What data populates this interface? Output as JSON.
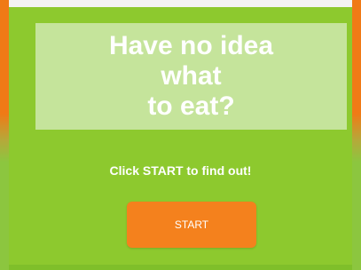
{
  "headline": {
    "line1": "Have no idea",
    "line2": "what",
    "line3": "to eat?"
  },
  "prompt": "Click START to find out!",
  "start_button": {
    "label": "START"
  },
  "colors": {
    "frame": "#f07a16",
    "background": "#8dc92e",
    "headline_box": "#c5e49b",
    "button": "#f4811d",
    "text": "#ffffff"
  }
}
